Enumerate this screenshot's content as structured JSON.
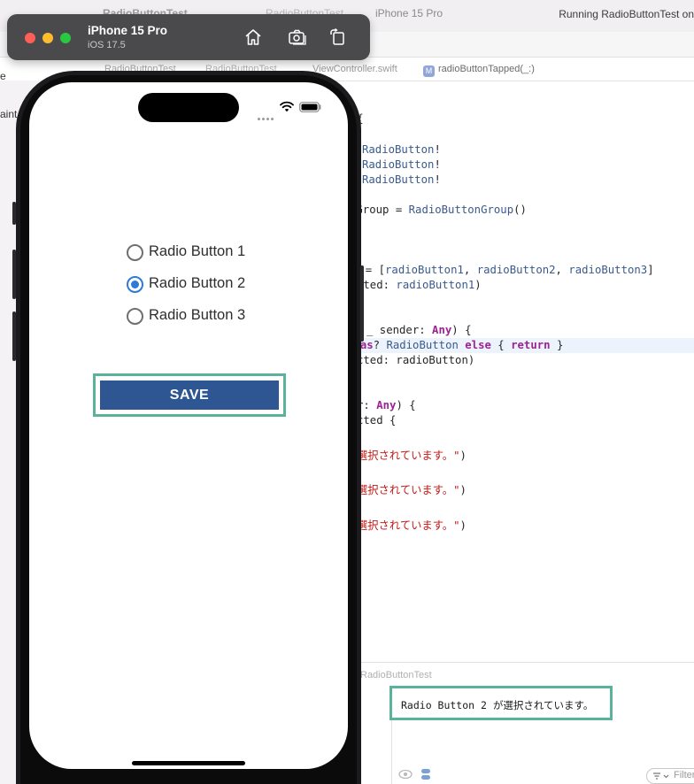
{
  "xcode": {
    "scheme_name": "RadioButtonTest",
    "scheme_tab": "RadioButtonTest",
    "device_tab": "iPhone 15 Pro",
    "run_status": "Running RadioButtonTest on",
    "jumpbar": {
      "project": "RadioButtonTest",
      "group": "RadioButtonTest",
      "file": "ViewController.swift",
      "method_badge": "M",
      "method": "radioButtonTapped(_:)"
    },
    "navigator_fragments": [
      "e",
      "aint"
    ],
    "code": {
      "l1_rest": "er {",
      "l2_type": "RadioButton",
      "l2_rest": "!",
      "l3_type": "RadioButton",
      "l3_rest": "!",
      "l4_type": "RadioButton",
      "l4_rest": "!",
      "l5_a": "nGroup = ",
      "l5_type": "RadioButtonGroup",
      "l5_b": "()",
      "l6_a": "s = [",
      "l6_v1": "radioButton1",
      "l6_sep1": ", ",
      "l6_v2": "radioButton2",
      "l6_sep2": ", ",
      "l6_v3": "radioButton3",
      "l6_b": "]",
      "l7_a": "cted: ",
      "l7_v": "radioButton1",
      "l7_b": ")",
      "l8_a": "_ sender: ",
      "l8_kw": "Any",
      "l8_b": ") {",
      "l9_a": "r ",
      "l9_kw1": "as",
      "l9_b": "? ",
      "l9_type": "RadioButton",
      "l9_c": " ",
      "l9_kw2": "else",
      "l9_d": " { ",
      "l9_kw3": "return",
      "l9_e": " }",
      "l10_a": "cted: radioButton)",
      "l11_a": "r: ",
      "l11_kw": "Any",
      "l11_b": ") {",
      "l12_a": "cted {",
      "l13_str": "選択されています。\"",
      "l13_b": ")",
      "l14_str": "選択されています。\"",
      "l14_b": ")",
      "l15_str": "選択されています。\"",
      "l15_b": ")",
      "l16_a": ")"
    },
    "console": {
      "target": "RadioButtonTest",
      "output": "Radio Button 2 が選択されています。",
      "filter_placeholder": "Filter"
    }
  },
  "simulator": {
    "device_name": "iPhone 15 Pro",
    "os_version": "iOS 17.5",
    "toolbar_icons": [
      "home-icon",
      "screenshot-icon",
      "rotate-icon"
    ],
    "traffic_lights": {
      "close": "#ff5f57",
      "minimize": "#febc2e",
      "zoom": "#28c840"
    }
  },
  "app": {
    "radio_options": [
      {
        "label": "Radio Button 1",
        "selected": false
      },
      {
        "label": "Radio Button 2",
        "selected": true
      },
      {
        "label": "Radio Button 3",
        "selected": false
      }
    ],
    "save_label": "SAVE",
    "colors": {
      "accent": "#2f7ad6",
      "save_button": "#2d5693",
      "highlight_frame": "#5bb29b"
    }
  }
}
